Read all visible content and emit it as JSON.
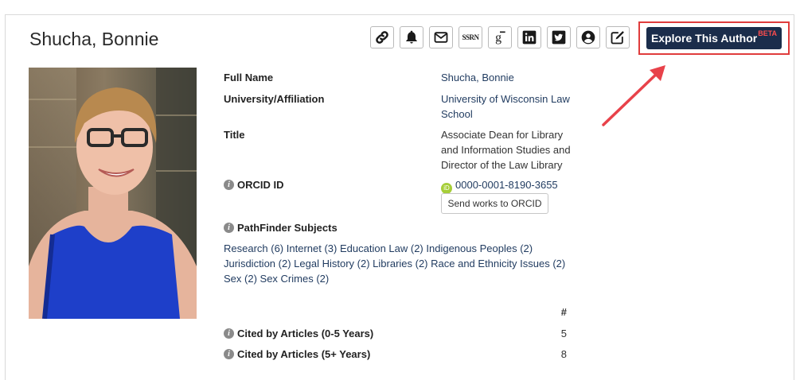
{
  "author": {
    "name": "Shucha, Bonnie"
  },
  "toolbar": {
    "buttons": [
      {
        "icon": "link-icon"
      },
      {
        "icon": "bell-icon"
      },
      {
        "icon": "envelope-icon"
      },
      {
        "icon": "ssrn-icon",
        "text": "SSRN"
      },
      {
        "icon": "google-scholar-icon"
      },
      {
        "icon": "linkedin-icon"
      },
      {
        "icon": "twitter-icon"
      },
      {
        "icon": "user-circle-icon"
      },
      {
        "icon": "edit-icon"
      }
    ],
    "explore_label": "Explore This Author",
    "beta_label": "BETA"
  },
  "details": {
    "full_name_label": "Full Name",
    "full_name_value": "Shucha, Bonnie",
    "affiliation_label": "University/Affiliation",
    "affiliation_value_line1": "University of Wisconsin Law",
    "affiliation_value_line2": "School",
    "title_label": "Title",
    "title_line1": "Associate Dean for Library",
    "title_line2": "and Information Studies and",
    "title_line3": "Director of the Law Library",
    "orcid_label": "ORCID ID",
    "orcid_badge": "iD",
    "orcid_value": "0000-0001-8190-3655",
    "orcid_button": "Send works to ORCID"
  },
  "pathfinder": {
    "label": "PathFinder Subjects",
    "subjects": [
      "Research (6)",
      "Internet (3)",
      "Education Law (2)",
      "Indigenous Peoples (2)",
      "Jurisdiction (2)",
      "Legal History (2)",
      "Libraries (2)",
      "Race and Ethnicity Issues (2)",
      "Sex (2)",
      "Sex Crimes (2)"
    ]
  },
  "citations": {
    "header": "#",
    "rows": [
      {
        "label": "Cited by Articles (0-5 Years)",
        "value": "5"
      },
      {
        "label": "Cited by Articles (5+ Years)",
        "value": "8"
      }
    ]
  },
  "colors": {
    "accent": "#1b2d4b",
    "highlight": "#e03c3c",
    "link": "#1f3a5f",
    "beta": "#ff4d4d",
    "orcid": "#a6ce39"
  }
}
